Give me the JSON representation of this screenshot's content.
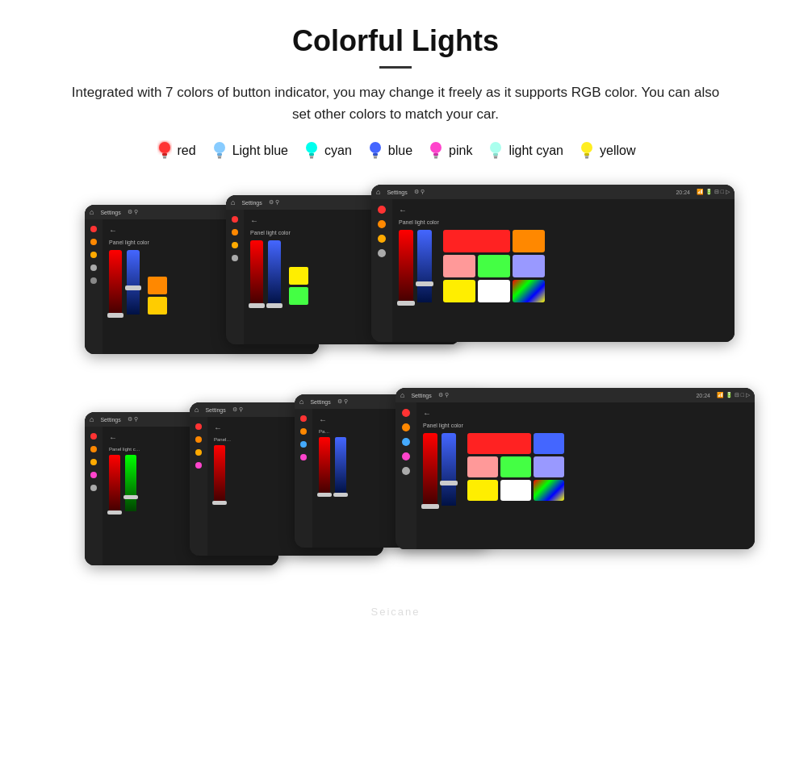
{
  "header": {
    "title": "Colorful Lights",
    "subtitle": "Integrated with 7 colors of button indicator, you may change it freely as it supports RGB color. You can also set other colors to match your car."
  },
  "colors": [
    {
      "name": "red",
      "hex": "#ff2222",
      "glow": "#ff6666"
    },
    {
      "name": "Light blue",
      "hex": "#88ccff",
      "glow": "#aaddff"
    },
    {
      "name": "cyan",
      "hex": "#00ffee",
      "glow": "#66ffee"
    },
    {
      "name": "blue",
      "hex": "#4466ff",
      "glow": "#6688ff"
    },
    {
      "name": "pink",
      "hex": "#ff44cc",
      "glow": "#ff88ee"
    },
    {
      "name": "light cyan",
      "hex": "#88ffee",
      "glow": "#aaffee"
    },
    {
      "name": "yellow",
      "hex": "#ffee22",
      "glow": "#ffee88"
    }
  ],
  "screens": {
    "topbar_label": "Settings",
    "content_label": "Panel light color",
    "back_label": "←",
    "time": "20:24"
  },
  "watermark": "Seicane"
}
